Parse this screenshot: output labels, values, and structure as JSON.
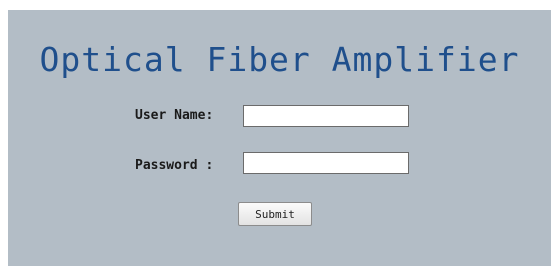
{
  "page": {
    "title": "Optical Fiber Amplifier"
  },
  "form": {
    "username_label": "User Name:",
    "username_value": "",
    "password_label": "Password :",
    "password_value": "",
    "submit_label": "Submit"
  },
  "colors": {
    "panel_background": "#b3bdc6",
    "title_color": "#1f4f8c"
  }
}
